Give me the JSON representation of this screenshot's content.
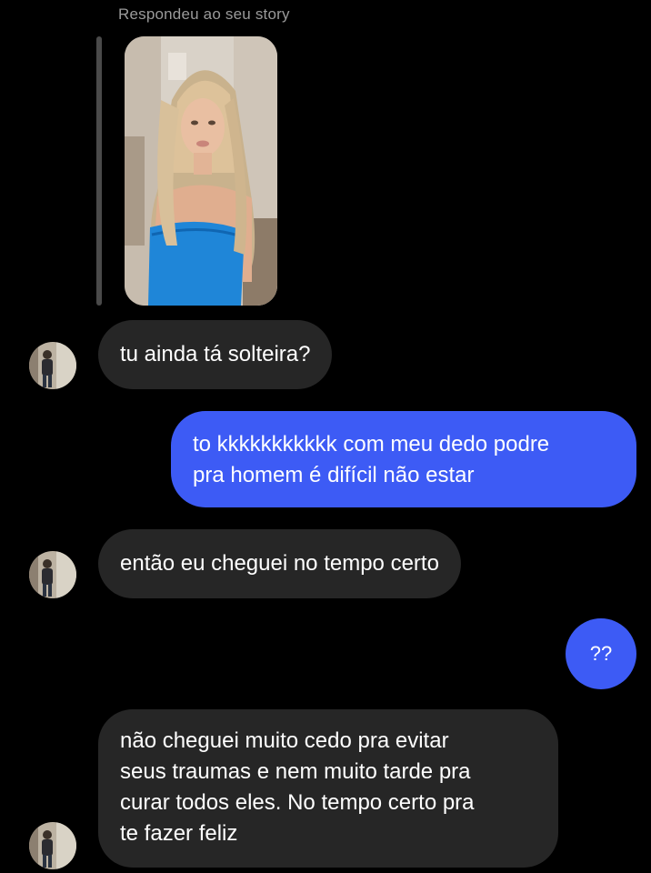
{
  "story_reply": {
    "caption": "Respondeu ao seu story"
  },
  "messages": [
    {
      "sender": "other",
      "text": "tu ainda tá solteira?"
    },
    {
      "sender": "me",
      "text": "to kkkkkkkkkkk com meu dedo podre\npra homem é difícil não estar"
    },
    {
      "sender": "other",
      "text": "então eu cheguei no tempo certo"
    },
    {
      "sender": "me",
      "text": "??"
    },
    {
      "sender": "other",
      "text": "não cheguei muito cedo pra evitar\nseus traumas e nem muito tarde pra\ncurar todos eles. No tempo certo pra\nte fazer feliz"
    }
  ],
  "colors": {
    "background": "#000000",
    "incoming_bubble": "#262626",
    "outgoing_bubble": "#3d5bf5",
    "caption_text": "#9a9a9a"
  }
}
